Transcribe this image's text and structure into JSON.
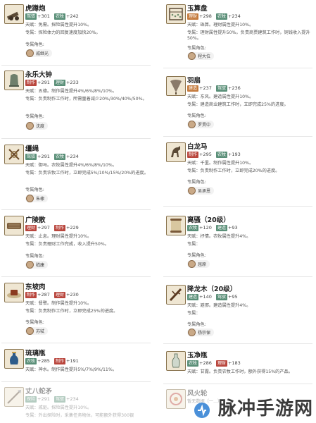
{
  "labels": {
    "special_role": "专属角色:"
  },
  "left": [
    {
      "name": "虎蹲炮",
      "tags": [
        [
          "g",
          "驾驭"
        ],
        [
          "g",
          "农牧"
        ]
      ],
      "vals": [
        "+301",
        "+242"
      ],
      "talent": "天赋：免需。探险属性提升10%。",
      "effect": "专属：探险体力的回复速度加快20%。",
      "role": "戚继光"
    },
    {
      "name": "永乐大钟",
      "tags": [
        [
          "r",
          "制作"
        ]
      ],
      "vals": [
        "+291",
        "+233"
      ],
      "mid_tag": [
        "g",
        "理财"
      ],
      "talent": "天赋：五德。制作属性提升4%/6%/8%/10%。",
      "effect": "专属：负责制作工作时，所需量着减少20%/30%/40%/50%。",
      "role": "沈度"
    },
    {
      "name": "缰绳",
      "tags": [
        [
          "g",
          "驾驭"
        ],
        [
          "g",
          "农牧"
        ]
      ],
      "vals": [
        "+291",
        "+234"
      ],
      "talent": "天赋：御马。农牧属性提升4%/6%/8%/10%。",
      "effect": "专属：负责农牧工作时，立即完成5%/10%/15%/20%的进度。",
      "role": "朱棣"
    },
    {
      "name": "广陵散",
      "tags": [
        [
          "r",
          "理财"
        ],
        [
          "r",
          "制作"
        ]
      ],
      "vals": [
        "+297",
        "+229"
      ],
      "talent": "天赋：止息。理财属性提升10%。",
      "effect": "专属：负责理财工作完成，收入提升50%。",
      "role": "嵇康"
    },
    {
      "name": "东坡肉",
      "tags": [
        [
          "r",
          "制作"
        ],
        [
          "r",
          "理财"
        ]
      ],
      "vals": [
        "+287",
        "+230"
      ],
      "talent": "天赋：餐餮。制作属性提升10%。",
      "effect": "专属：负责制作工作时，立即完成25%的进度。",
      "role": "苏轼"
    },
    {
      "name": "琉璃瓶",
      "tags": [
        [
          "g",
          "农牧"
        ],
        [
          "r",
          "制作"
        ]
      ],
      "vals": [
        "+285",
        "+191"
      ],
      "talent": "天赋：神水。制作属性提升5%/7%/9%/11%。",
      "role": ""
    },
    {
      "name": "丈八蛇矛",
      "tags": [
        [
          "g",
          "探险"
        ],
        [
          "g",
          "驾驭"
        ]
      ],
      "vals": [
        "+291",
        "+234"
      ],
      "talent": "天赋：戚驱。探险属性提升10%。",
      "effect": "专属：外出探险时，采集任务物体，可能额外获得300银",
      "role": ""
    }
  ],
  "right": [
    {
      "name": "玉算盘",
      "tags": [
        [
          "o",
          "理财"
        ],
        [
          "g",
          "农牧"
        ]
      ],
      "vals": [
        "+298",
        "+234"
      ],
      "talent": "天赋：珠算。理财属性提升10%。",
      "effect": "专属：理财属性提升50%。负责商贾建筑工作时，铜钱收入提升50%。",
      "role": "程大位"
    },
    {
      "name": "羽扇",
      "tags": [
        [
          "o",
          "建造"
        ],
        [
          "g",
          "驾驭"
        ]
      ],
      "vals": [
        "+237",
        "+236"
      ],
      "talent": "天赋：东风。建造属性提升10%。",
      "effect": "专属：建造商业建筑工作时，立即完成25%的进度。",
      "role": "罗贯中"
    },
    {
      "name": "白龙马",
      "tags": [
        [
          "r",
          "制作"
        ],
        [
          "g",
          "农牧"
        ]
      ],
      "vals": [
        "+295",
        "+193"
      ],
      "talent": "天赋：千里。制作属性提升10%。",
      "effect": "专属：负责制作工作时，立即完成20%的进度。",
      "role": "吴承恩"
    },
    {
      "name": "离骚（20级）",
      "tags": [
        [
          "g",
          "农牧"
        ],
        [
          "g",
          "建造"
        ]
      ],
      "vals": [
        "+120",
        "+93"
      ],
      "talent": "天赋：抒情。农牧属性提升4%。",
      "effect": "专属：",
      "role": "屈原"
    },
    {
      "name": "降龙木（20级）",
      "tags": [
        [
          "g",
          "建造"
        ],
        [
          "g",
          "驾驭"
        ]
      ],
      "vals": [
        "+140",
        "+95"
      ],
      "talent": "天赋：避邪。建造属性提升4%。",
      "effect": "专属：",
      "role": "杨宗保"
    },
    {
      "name": "玉净瓶",
      "tags": [
        [
          "g",
          "农牧"
        ],
        [
          "r",
          "理财"
        ]
      ],
      "vals": [
        "+286",
        "+183"
      ],
      "talent": "天赋：甘露。负责农牧工作时，额外获得15%的产品。",
      "role": ""
    },
    {
      "name": "风火轮",
      "tags": [],
      "vals": [],
      "talent": "暂无数据（一...）",
      "role": ""
    }
  ],
  "watermark": "脉冲手游网"
}
